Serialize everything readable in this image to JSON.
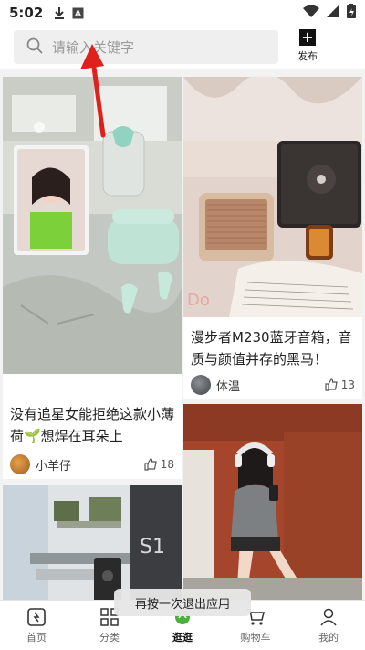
{
  "status_bar": {
    "time": "5:02"
  },
  "search": {
    "placeholder": "请输入关键字"
  },
  "publish": {
    "label": "发布"
  },
  "posts": [
    {
      "title": "没有追星女能拒绝这款小薄荷🌱想焊在耳朵上",
      "author": "小羊仔",
      "likes": "18"
    },
    {
      "title": "漫步者M230蓝牙音箱，音质与颜值并存的黑马！",
      "author": "体温",
      "likes": "13"
    }
  ],
  "toast": "再按一次退出应用",
  "tabs": [
    {
      "label": "首页",
      "icon": "home-icon"
    },
    {
      "label": "分类",
      "icon": "grid-icon"
    },
    {
      "label": "逛逛",
      "icon": "explore-icon"
    },
    {
      "label": "购物车",
      "icon": "cart-icon"
    },
    {
      "label": "我的",
      "icon": "user-icon"
    }
  ],
  "colors": {
    "accent": "#111111",
    "arrow": "#e0201c"
  }
}
